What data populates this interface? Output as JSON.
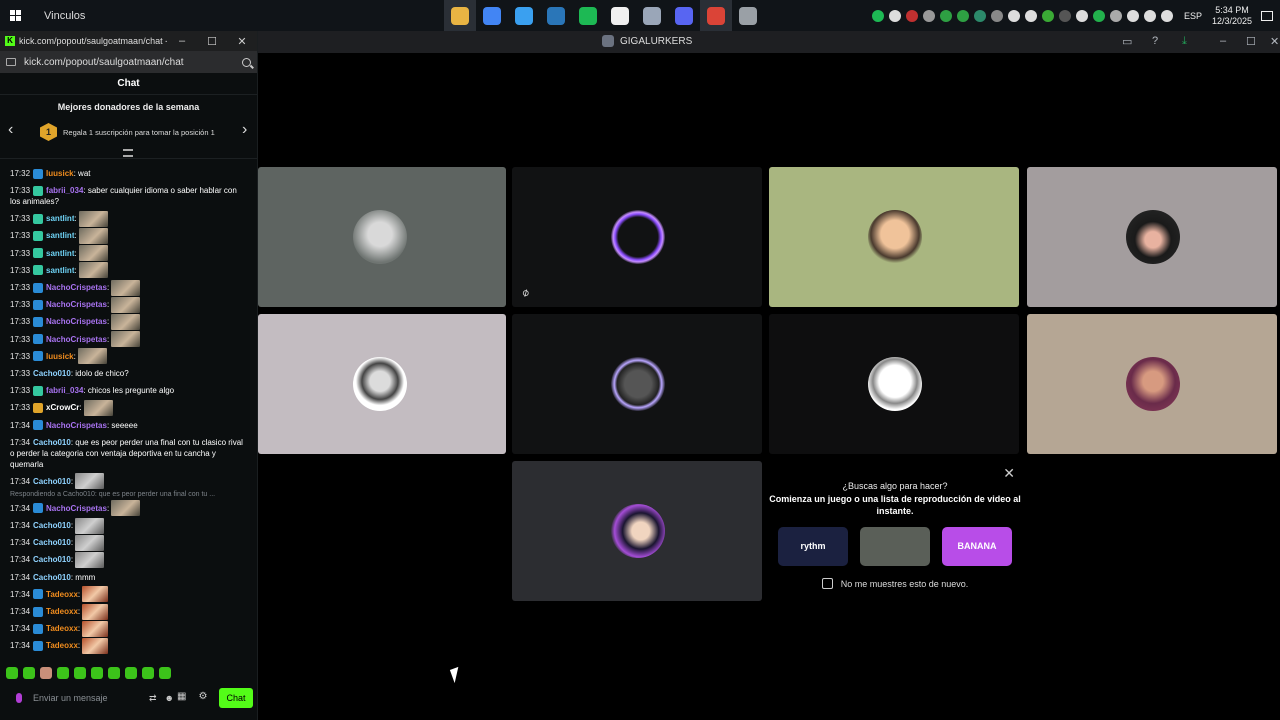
{
  "taskbar": {
    "search_label": "Vinculos",
    "apps": [
      {
        "icon": "file-explorer-icon",
        "color": "#e8b443",
        "active": true
      },
      {
        "icon": "chrome-icon",
        "color": "#4285f4",
        "active": false
      },
      {
        "icon": "copilot-icon",
        "color": "#3aa0f0",
        "active": false
      },
      {
        "icon": "steam-icon",
        "color": "#2a76b8",
        "active": false
      },
      {
        "icon": "spotify-icon",
        "color": "#1db954",
        "active": false
      },
      {
        "icon": "microsoft-store-icon",
        "color": "#f0f0f0",
        "active": false
      },
      {
        "icon": "photos-icon",
        "color": "#9aa6b8",
        "active": false
      },
      {
        "icon": "discord-icon",
        "color": "#5865f2",
        "active": false
      },
      {
        "icon": "chrome-icon",
        "color": "#db4437",
        "active": true
      },
      {
        "icon": "clock-app-icon",
        "color": "#9aa0a6",
        "active": false
      }
    ],
    "tray": {
      "language": "ESP",
      "time": "5:34 PM",
      "date": "12/3/2025"
    }
  },
  "chat_window": {
    "title": "kick.com/popout/saulgoatmaan/chat - ...",
    "url": "kick.com/popout/saulgoatmaan/chat",
    "header": "Chat",
    "donors": {
      "title": "Mejores donadores de la semana",
      "rank": "1",
      "slot_text": "Regala 1 suscripción para tomar la posición 1"
    },
    "messages": [
      {
        "time": "17:32",
        "badge": "#2a8bd6",
        "user": "luusick",
        "color": "#f08c1e",
        "text": ": wat"
      },
      {
        "time": "17:33",
        "badge": "#35c8a0",
        "user": "fabrii_034",
        "color": "#a873f0",
        "text": ": saber cualquier idioma o saber hablar con los animales?",
        "multi": true
      },
      {
        "time": "17:33",
        "badge": "#35c8a0",
        "user": "santlint",
        "color": "#6fd4f7",
        "text": ":",
        "emote": "face"
      },
      {
        "time": "17:33",
        "badge": "#35c8a0",
        "user": "santlint",
        "color": "#6fd4f7",
        "text": ":",
        "emote": "face"
      },
      {
        "time": "17:33",
        "badge": "#35c8a0",
        "user": "santlint",
        "color": "#6fd4f7",
        "text": ":",
        "emote": "face"
      },
      {
        "time": "17:33",
        "badge": "#35c8a0",
        "user": "santlint",
        "color": "#6fd4f7",
        "text": ":",
        "emote": "face"
      },
      {
        "time": "17:33",
        "badge": "#2a8bd6",
        "user": "NachoCrispetas",
        "color": "#a873f0",
        "text": ":",
        "emote": "face"
      },
      {
        "time": "17:33",
        "badge": "#2a8bd6",
        "user": "NachoCrispetas",
        "color": "#a873f0",
        "text": ":",
        "emote": "face"
      },
      {
        "time": "17:33",
        "badge": "#2a8bd6",
        "user": "NachoCrispetas",
        "color": "#a873f0",
        "text": ":",
        "emote": "face"
      },
      {
        "time": "17:33",
        "badge": "#2a8bd6",
        "user": "NachoCrispetas",
        "color": "#a873f0",
        "text": ":",
        "emote": "face"
      },
      {
        "time": "17:33",
        "badge": "#2a8bd6",
        "user": "luusick",
        "color": "#f08c1e",
        "text": ":",
        "emote": "face"
      },
      {
        "time": "17:33",
        "badge": "",
        "user": "Cacho010",
        "color": "#8fd3ff",
        "text": ": idolo de chico?"
      },
      {
        "time": "17:33",
        "badge": "#35c8a0",
        "user": "fabrii_034",
        "color": "#a873f0",
        "text": ": chicos les pregunte algo"
      },
      {
        "time": "17:33",
        "badge": "#e0a42a",
        "user": "xCrowCr",
        "color": "#ffffff",
        "text": ":",
        "emote": "face"
      },
      {
        "time": "17:34",
        "badge": "#2a8bd6",
        "user": "NachoCrispetas",
        "color": "#a873f0",
        "text": ": seeeee"
      },
      {
        "time": "17:34",
        "badge": "",
        "user": "Cacho010",
        "color": "#8fd3ff",
        "text": ": que es peor perder una final con tu clasico rival o perder la categoria con ventaja deportiva en tu cancha y quemarla",
        "multi": true
      },
      {
        "time": "17:34",
        "badge": "",
        "user": "Cacho010",
        "color": "#8fd3ff",
        "text": ":",
        "emote": "gray"
      },
      {
        "time": "17:34",
        "badge": "#2a8bd6",
        "user": "NachoCrispetas",
        "color": "#a873f0",
        "text": ":",
        "emote": "face",
        "reply": "Respondiendo a Cacho010: que es peor perder una final con tu ..."
      },
      {
        "time": "17:34",
        "badge": "",
        "user": "Cacho010",
        "color": "#8fd3ff",
        "text": ":",
        "emote": "gray"
      },
      {
        "time": "17:34",
        "badge": "",
        "user": "Cacho010",
        "color": "#8fd3ff",
        "text": ":",
        "emote": "gray"
      },
      {
        "time": "17:34",
        "badge": "",
        "user": "Cacho010",
        "color": "#8fd3ff",
        "text": ":",
        "emote": "gray"
      },
      {
        "time": "17:34",
        "badge": "",
        "user": "Cacho010",
        "color": "#8fd3ff",
        "text": ": mmm"
      },
      {
        "time": "17:34",
        "badge": "#2a8bd6",
        "user": "Tadeoxx",
        "color": "#f08c1e",
        "text": ":",
        "emote": "red"
      },
      {
        "time": "17:34",
        "badge": "#2a8bd6",
        "user": "Tadeoxx",
        "color": "#f08c1e",
        "text": ":",
        "emote": "red"
      },
      {
        "time": "17:34",
        "badge": "#2a8bd6",
        "user": "Tadeoxx",
        "color": "#f08c1e",
        "text": ":",
        "emote": "red"
      },
      {
        "time": "17:34",
        "badge": "#2a8bd6",
        "user": "Tadeoxx",
        "color": "#f08c1e",
        "text": ":",
        "emote": "red"
      }
    ],
    "input_placeholder": "Enviar un mensaje",
    "send_label": "Chat"
  },
  "discord": {
    "server_name": "GIGALURKERS",
    "tiles": [
      {
        "bg": "#5e6461",
        "avatar": "radial-gradient(circle at 50% 45%, #d9d9d9 0 30%, #6f7572 70%)",
        "muted": false
      },
      {
        "bg": "#111213",
        "avatar": "radial-gradient(circle, #111213 0 52%, #8b4dff 60%, #c58dff 65%, #111213 72%)",
        "muted": true
      },
      {
        "bg": "#a9b680",
        "avatar": "radial-gradient(circle at 50% 45%, #f0c39a 0 35%, #4a3a2e 60%, #a9b680 72%)",
        "muted": false
      },
      {
        "bg": "#a39d9e",
        "avatar": "radial-gradient(circle at 50% 55%, #e8b2a0 0 20%, #1a1a1a 45%, #2a2a2a 100%)",
        "muted": false
      },
      {
        "bg": "#c3bcc1",
        "avatar": "radial-gradient(circle at 50% 45%, #dcdcdc 0 25%, #444 45%, #fff 60%)",
        "muted": false
      },
      {
        "bg": "#111213",
        "avatar": "radial-gradient(circle, #555 0 35%, #222 55%, #b9a6ff 62%, #111213 72%)",
        "muted": false
      },
      {
        "bg": "#0e0e0f",
        "avatar": "radial-gradient(circle at 50% 45%, #fff 0 40%, #888 55%, #fff 70%)",
        "muted": false
      },
      {
        "bg": "#b5a694",
        "avatar": "radial-gradient(circle at 50% 45%, #d79a80 0 25%, #6a2b4a 55%, #8c3b5a 100%)",
        "muted": false
      },
      {
        "bg": "#2c2d31",
        "avatar": "radial-gradient(circle at 55% 50%, #f1d5c0 0 22%, #1a1530 45%, #a44dd6 65%, #2c2d31 75%)",
        "muted": false
      }
    ],
    "suggestion": {
      "heading": "¿Buscas algo para hacer?",
      "subheading": "Comienza un juego o una lista de reproducción de video al instante.",
      "activities": [
        {
          "label": "rythm",
          "bg": "#1b2140"
        },
        {
          "label": "",
          "bg": "#5a5f58"
        },
        {
          "label": "BANANA",
          "bg": "#b84de8"
        }
      ],
      "checkbox_label": "No me muestres esto de nuevo."
    }
  }
}
